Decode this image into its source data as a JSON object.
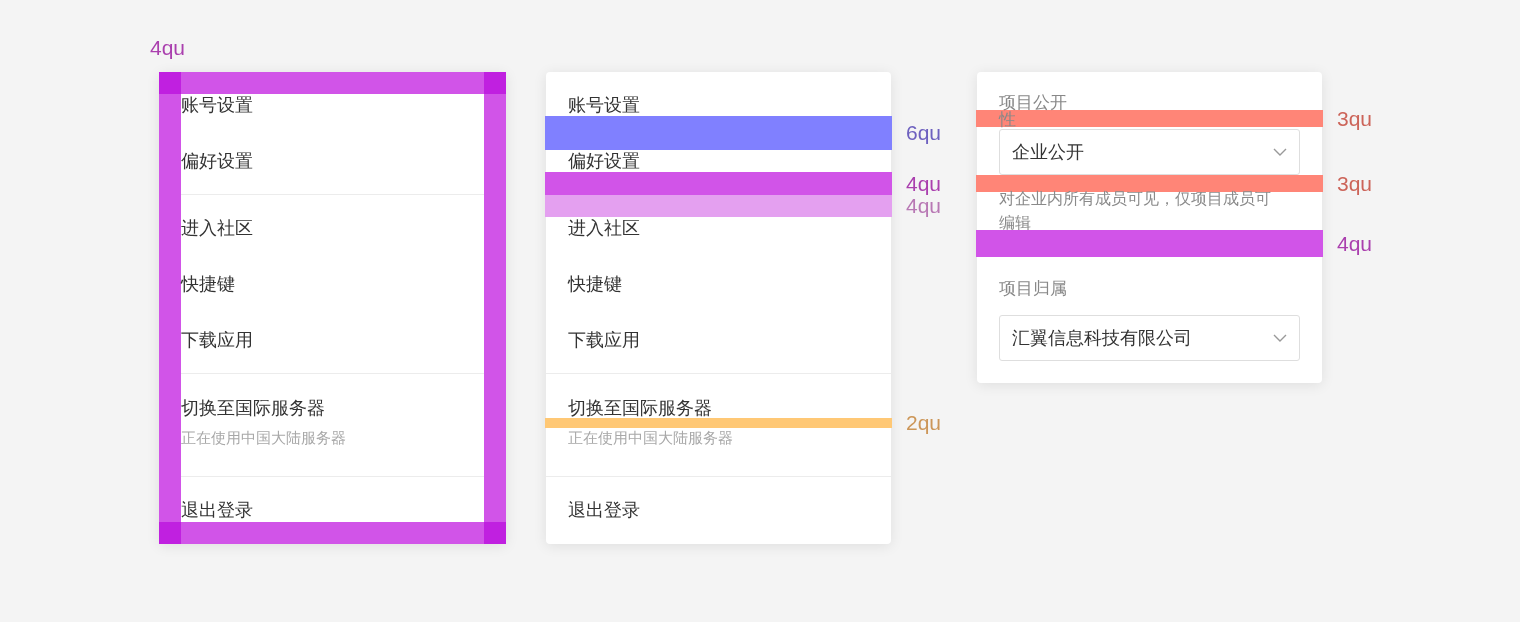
{
  "specimens": [
    {
      "kind": "menu",
      "annotations": [
        {
          "label": "4qu",
          "color": "#d154e8"
        }
      ],
      "groups": [
        {
          "items": [
            {
              "title": "账号设置"
            },
            {
              "title": "偏好设置"
            }
          ]
        },
        {
          "items": [
            {
              "title": "进入社区"
            },
            {
              "title": "快捷键"
            },
            {
              "title": "下载应用"
            }
          ]
        },
        {
          "items": [
            {
              "title": "切换至国际服务器",
              "subtitle": "正在使用中国大陆服务器"
            }
          ]
        },
        {
          "items": [
            {
              "title": "退出登录"
            }
          ]
        }
      ]
    },
    {
      "kind": "menu",
      "annotations": [
        {
          "label": "6qu",
          "color": "#8080ff"
        },
        {
          "label": "4qu",
          "color": "#d154e8"
        },
        {
          "label": "4qu",
          "color": "#e4a0f0"
        },
        {
          "label": "2qu",
          "color": "#ffc875"
        }
      ],
      "groups": [
        {
          "items": [
            {
              "title": "账号设置"
            },
            {
              "title": "偏好设置"
            }
          ]
        },
        {
          "items": [
            {
              "title": "进入社区"
            },
            {
              "title": "快捷键"
            },
            {
              "title": "下载应用"
            }
          ]
        },
        {
          "items": [
            {
              "title": "切换至国际服务器",
              "subtitle": "正在使用中国大陆服务器"
            }
          ]
        },
        {
          "items": [
            {
              "title": "退出登录"
            }
          ]
        }
      ]
    },
    {
      "kind": "form",
      "annotations": [
        {
          "label": "3qu",
          "color": "#ff8577"
        },
        {
          "label": "3qu",
          "color": "#ff8577"
        },
        {
          "label": "4qu",
          "color": "#d154e8"
        }
      ],
      "fields": [
        {
          "label": "项目公开性",
          "value": "企业公开",
          "hint": "对企业内所有成员可见，仅项目成员可编辑"
        },
        {
          "label": "项目归属",
          "value": "汇翼信息科技有限公司"
        }
      ]
    }
  ]
}
